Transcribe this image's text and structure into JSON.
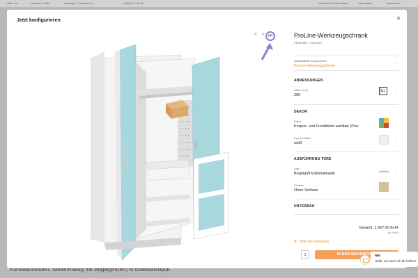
{
  "site": {
    "nav": [
      "Über uns",
      "Kontakt & Hilfe",
      "Kataloge & Informieren",
      "+49(0)2 67 35 44",
      "Händler & Außendienst",
      "Merkzettel",
      "Warenkorb"
    ],
    "bg_text": "Kunststoffkisten. Serienmäßig mit Bügelgriff(en) in Edelstahloptik."
  },
  "modal": {
    "title": "Jetzt konfigurieren",
    "close": "×",
    "view_tools": [
      "⇱",
      "↺"
    ],
    "ar": "AR"
  },
  "product": {
    "title": "ProLine-Werkzeugschrank",
    "sub": "PROLINE | 7231303",
    "component_label": "Ausgewählte Komponente",
    "component_value": "ProLine-Werkzeugschrank"
  },
  "sections": {
    "dimensions": "ABMESSUNGEN",
    "decor": "DEKOR",
    "door": "AUSFÜHRUNG TÜRE",
    "base": "UNTERBAU"
  },
  "fields": {
    "height_label": "Höhe in cm",
    "height_value": "200",
    "decor_label": "Dekor",
    "decor_value": "Korpus- und Frontdekor wählbar (Prei...",
    "body_decor_label": "Korpus-Dekor",
    "body_decor_value": "weiß",
    "handle_label": "Griff",
    "handle_value": "Bügelgriff Edelstahloptik",
    "lock_label": "Schloss",
    "lock_value": "Ohne Schloss"
  },
  "price": {
    "total": "Gesamt: 1.667,00 EUR",
    "vat": "inkl. MwSt"
  },
  "actions": {
    "pdf": "PDF herunterladen",
    "quantity": "1",
    "cart": "IN DEN WARENKORB"
  },
  "chat": {
    "name": "Niki",
    "message": "Hallo, wie kann ich dir helfen?"
  },
  "colors": {
    "accent": "#f5a05a",
    "door": "#a8d8de",
    "ar_ring": "#8a82d0"
  }
}
